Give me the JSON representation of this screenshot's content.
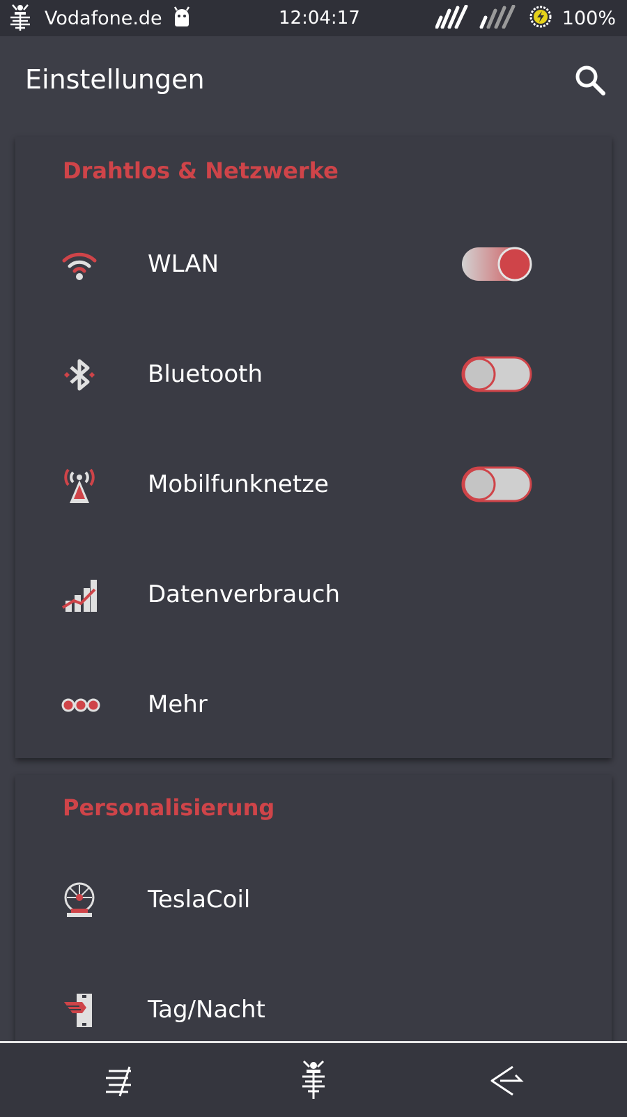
{
  "status_bar": {
    "carrier": "Vodafone.de",
    "time": "12:04:17",
    "battery": "100%"
  },
  "app_bar": {
    "title": "Einstellungen"
  },
  "sections": [
    {
      "title": "Drahtlos & Netzwerke",
      "items": [
        {
          "label": "WLAN",
          "icon": "wifi-icon",
          "toggle": true
        },
        {
          "label": "Bluetooth",
          "icon": "bluetooth-icon",
          "toggle": false
        },
        {
          "label": "Mobilfunknetze",
          "icon": "cell-tower-icon",
          "toggle": false
        },
        {
          "label": "Datenverbrauch",
          "icon": "data-usage-icon"
        },
        {
          "label": "Mehr",
          "icon": "more-icon"
        }
      ]
    },
    {
      "title": "Personalisierung",
      "items": [
        {
          "label": "TeslaCoil",
          "icon": "tesla-coil-icon"
        },
        {
          "label": "Tag/Nacht",
          "icon": "day-night-icon"
        }
      ]
    }
  ],
  "colors": {
    "accent": "#cf4449",
    "background": "#3d3e47",
    "card": "#3a3b44",
    "toggle_off": "#cfcfcf"
  }
}
